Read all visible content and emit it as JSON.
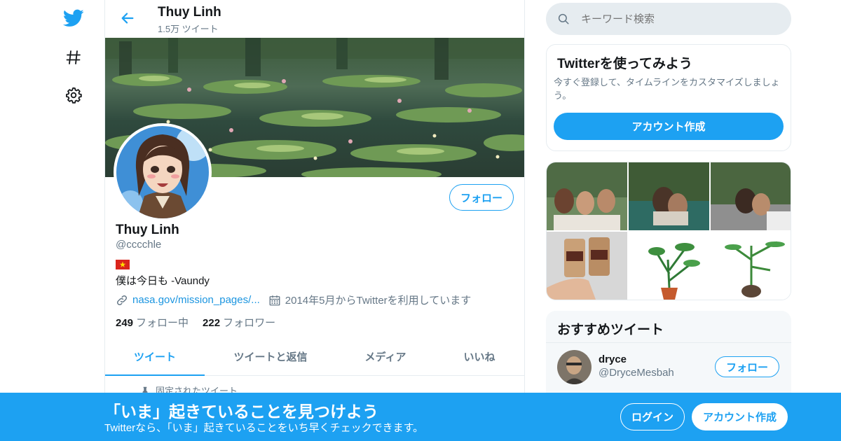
{
  "header": {
    "name": "Thuy Linh",
    "tweet_count": "1.5万 ツイート"
  },
  "profile": {
    "name": "Thuy Linh",
    "handle": "@cccchle",
    "bio": "僕は今日も  -Vaundy",
    "link": "nasa.gov/mission_pages/...",
    "joined": "2014年5月からTwitterを利用しています",
    "following_count": "249",
    "following_label": "フォロー中",
    "followers_count": "222",
    "followers_label": "フォロワー",
    "follow_button": "フォロー"
  },
  "tabs": [
    {
      "label": "ツイート"
    },
    {
      "label": "ツイートと返信"
    },
    {
      "label": "メディア"
    },
    {
      "label": "いいね"
    }
  ],
  "pinned_label": "固定されたツイート",
  "search": {
    "placeholder": "キーワード検索"
  },
  "signup_card": {
    "title": "Twitterを使ってみよう",
    "description": "今すぐ登録して、タイムラインをカスタマイズしましょう。",
    "button": "アカウント作成"
  },
  "recommend": {
    "title": "おすすめツイート",
    "user_name": "dryce",
    "user_handle": "@DryceMesbah",
    "follow_button": "フォロー"
  },
  "bottom_bar": {
    "title": "「いま」起きていることを見つけよう",
    "subtitle": "Twitterなら、「いま」起きていることをいち早くチェックできます。",
    "login": "ログイン",
    "signup": "アカウント作成"
  },
  "colors": {
    "accent": "#1da1f2",
    "text": "#14171a",
    "secondary": "#657786",
    "border": "#e6ecf0"
  }
}
